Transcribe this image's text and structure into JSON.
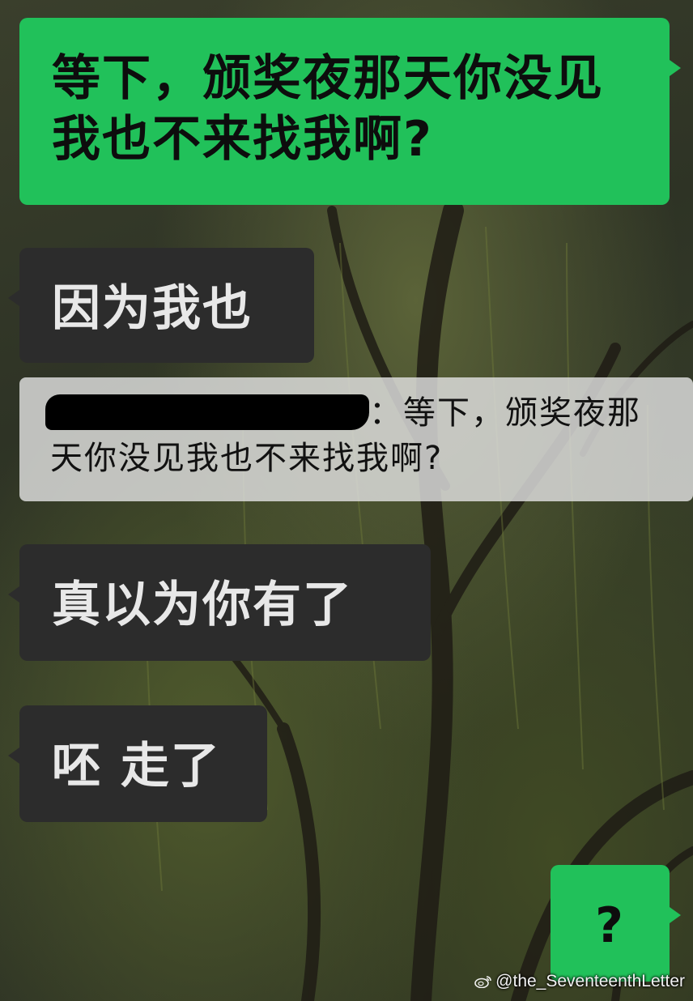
{
  "messages": [
    {
      "id": "msg1",
      "side": "outgoing",
      "text": "等下，颁奖夜那天你没见我也不来找我啊?"
    },
    {
      "id": "msg2",
      "side": "incoming",
      "text": "因为我也"
    },
    {
      "id": "msg3",
      "side": "incoming",
      "text": "真以为你有了"
    },
    {
      "id": "msg4",
      "side": "incoming",
      "text": "呸 走了"
    },
    {
      "id": "msg5",
      "side": "outgoing",
      "text": "?"
    }
  ],
  "quote": {
    "separator": "：",
    "text": "等下，颁奖夜那天你没见我也不来找我啊?"
  },
  "watermark": {
    "text": "@the_SeventeenthLetter",
    "icon": "weibo-icon"
  },
  "colors": {
    "outgoing_bubble": "#21c15a",
    "incoming_bubble": "#2c2c2c",
    "quote_bg": "#e1e1e1"
  }
}
